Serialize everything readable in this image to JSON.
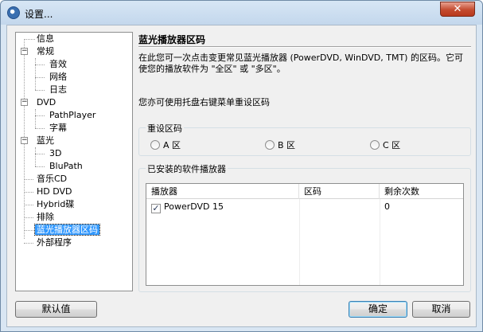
{
  "window": {
    "title": "设置...",
    "close_glyph": "✕"
  },
  "tree": {
    "items": [
      {
        "label": "信息"
      },
      {
        "label": "常规",
        "expander": "−"
      },
      {
        "label": "音效"
      },
      {
        "label": "网络"
      },
      {
        "label": "日志"
      },
      {
        "label": "DVD",
        "expander": "−"
      },
      {
        "label": "PathPlayer"
      },
      {
        "label": "字幕"
      },
      {
        "label": "蓝光",
        "expander": "−"
      },
      {
        "label": "3D"
      },
      {
        "label": "BluPath"
      },
      {
        "label": "音乐CD"
      },
      {
        "label": "HD DVD"
      },
      {
        "label": "Hybrid碟"
      },
      {
        "label": "排除"
      },
      {
        "label": "蓝光播放器区码",
        "selected": true
      },
      {
        "label": "外部程序"
      }
    ]
  },
  "panel": {
    "title": "蓝光播放器区码",
    "description": "在此您可一次点击变更常见蓝光播放器 (PowerDVD, WinDVD, TMT) 的区码。它可使您的播放软件为 \"全区\" 或 \"多区\"。",
    "hint": "您亦可使用托盘右键菜单重设区码",
    "reset_group": {
      "label": "重设区码",
      "options": [
        "A 区",
        "B 区",
        "C 区"
      ]
    },
    "installed_group": {
      "label": "已安装的软件播放器",
      "columns": [
        "播放器",
        "区码",
        "剩余次数"
      ],
      "rows": [
        {
          "player": "PowerDVD 15",
          "region": "",
          "remaining": "0",
          "checked": true
        }
      ]
    }
  },
  "buttons": {
    "defaults": "默认值",
    "ok": "确定",
    "cancel": "取消"
  },
  "icons": {
    "app": "disc-icon",
    "checkbox_mark": "✓"
  }
}
